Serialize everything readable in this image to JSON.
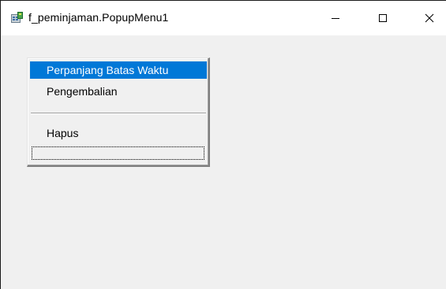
{
  "window": {
    "title": "f_peminjaman.PopupMenu1",
    "icon": "delphi-app-icon",
    "controls": {
      "minimize_icon": "minimize-icon",
      "maximize_icon": "maximize-icon",
      "close_icon": "close-icon"
    }
  },
  "popup_menu": {
    "items": [
      {
        "label": "Perpanjang Batas Waktu",
        "selected": true
      },
      {
        "label": "Pengembalian",
        "selected": false
      },
      {
        "type": "separator"
      },
      {
        "label": "Hapus",
        "selected": false
      },
      {
        "type": "empty-placeholder"
      }
    ],
    "selection_color": "#0078d7"
  },
  "colors": {
    "window_background": "#f0f0f0",
    "titlebar_background": "#ffffff",
    "selected_text": "#ffffff"
  }
}
